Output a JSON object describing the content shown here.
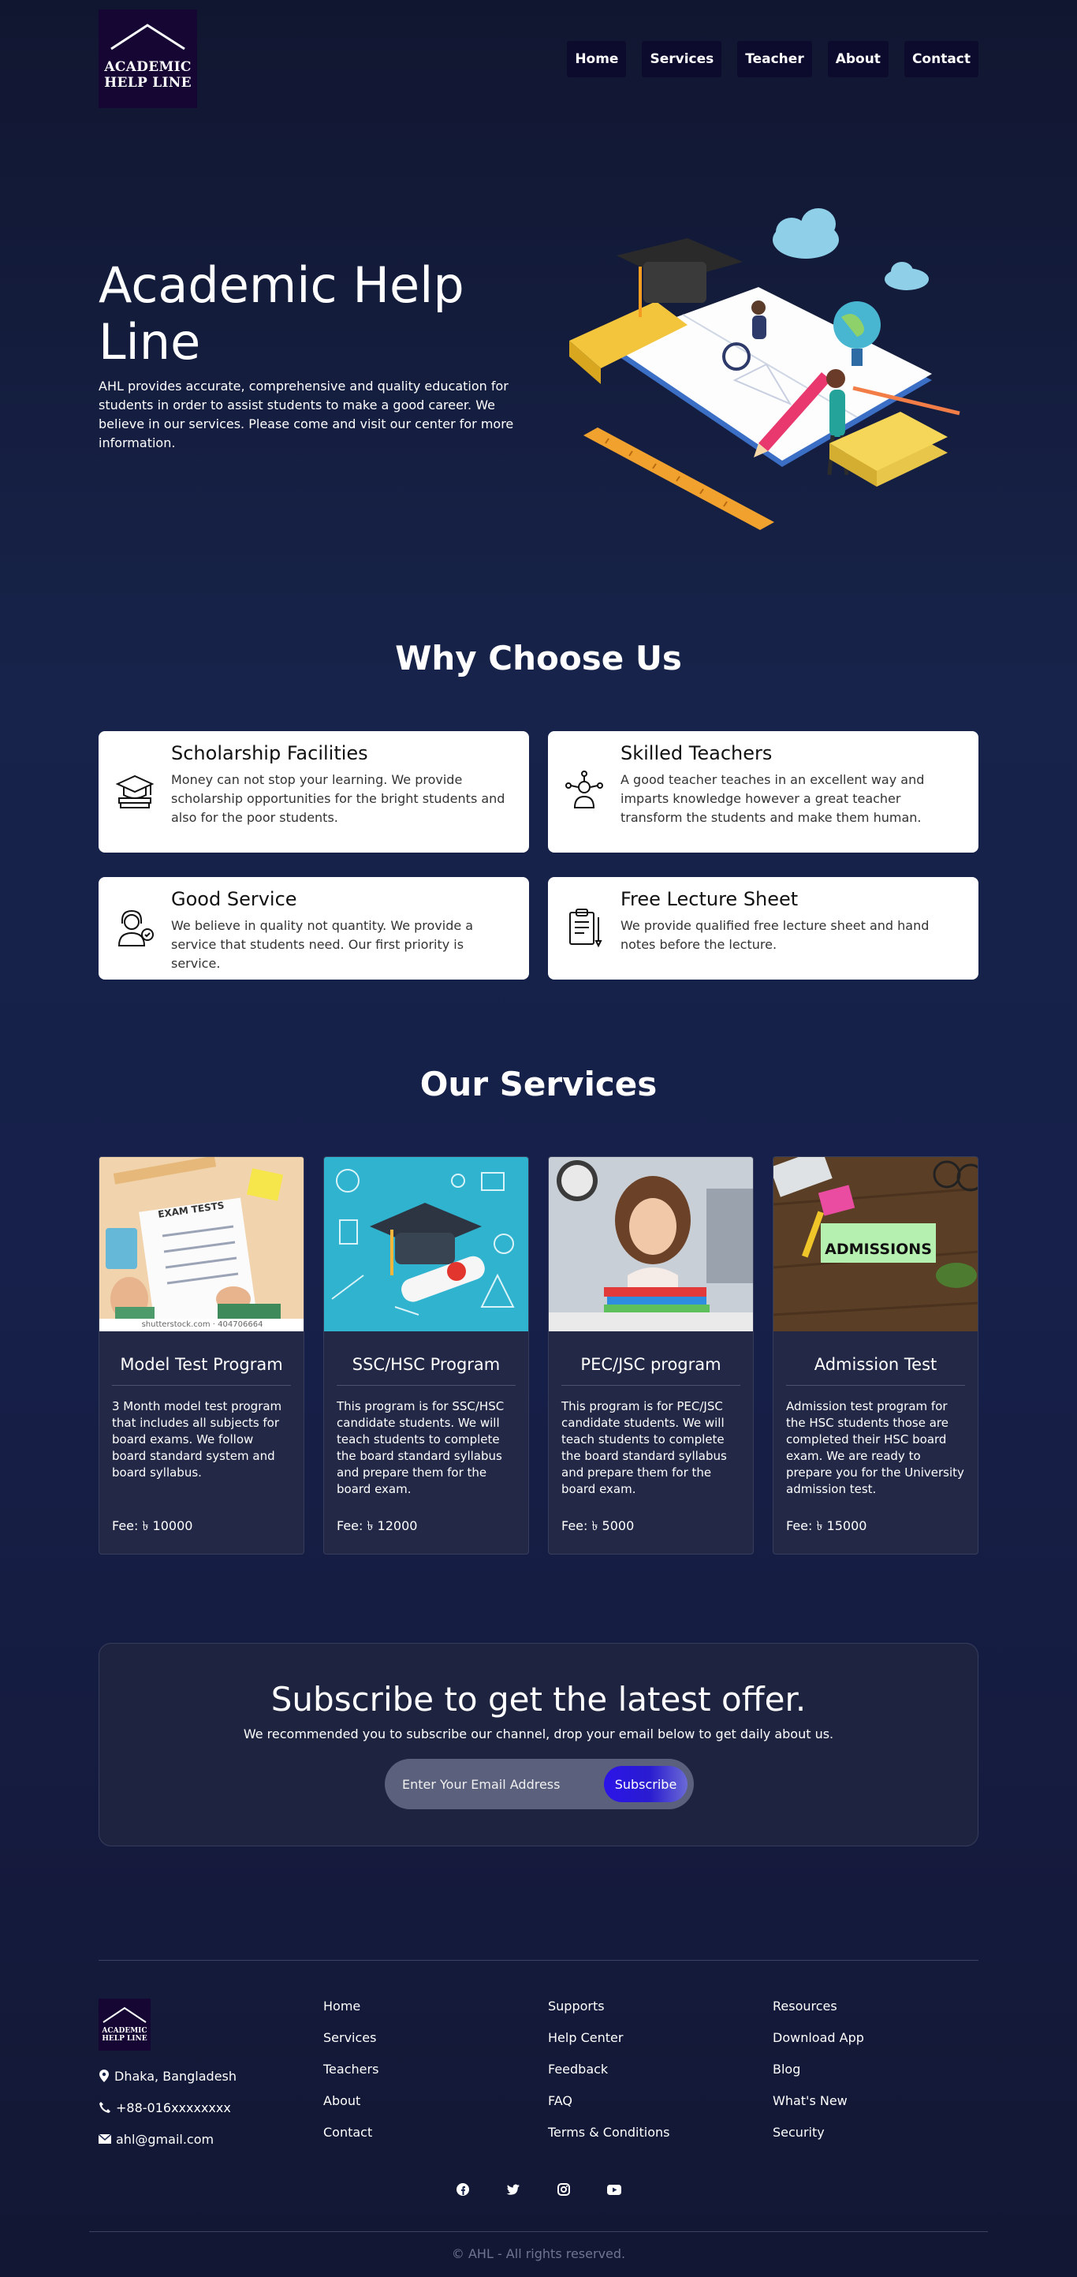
{
  "brand": {
    "logo_line1": "ACADEMIC",
    "logo_line2": "HELP LINE"
  },
  "nav": [
    {
      "label": "Home"
    },
    {
      "label": "Services"
    },
    {
      "label": "Teacher"
    },
    {
      "label": "About"
    },
    {
      "label": "Contact"
    }
  ],
  "hero": {
    "title": "Academic Help Line",
    "description": "AHL provides accurate, comprehensive and quality education for students in order to assist students to make a good career. We believe in our services. Please come and visit our center for more information."
  },
  "why": {
    "title": "Why Choose Us",
    "cards": [
      {
        "title": "Scholarship Facilities",
        "text": "Money can not stop your learning. We provide scholarship opportunities for the bright students and also for the poor students.",
        "icon": "graduation-books-icon"
      },
      {
        "title": "Skilled Teachers",
        "text": "A good teacher teaches in an excellent way and imparts knowledge however a great teacher transform the students and make them human.",
        "icon": "teacher-network-icon"
      },
      {
        "title": "Good Service",
        "text": "We believe in quality not quantity. We provide a service that students need. Our first priority is service.",
        "icon": "support-agent-icon"
      },
      {
        "title": "Free Lecture Sheet",
        "text": "We provide qualified free lecture sheet and hand notes before the lecture.",
        "icon": "lecture-sheet-icon"
      }
    ]
  },
  "services": {
    "title": "Our Services",
    "cards": [
      {
        "title": "Model Test Program",
        "text": "3 Month model test program that includes all subjects for board exams. We follow board standard system and board syllabus.",
        "fee": "Fee: ৳ 10000",
        "image_caption": "EXAM TESTS",
        "image_credit": "shutterstock.com · 404706664"
      },
      {
        "title": "SSC/HSC Program",
        "text": "This program is for SSC/HSC candidate students. We will teach students to complete the board standard syllabus and prepare them for the board exam.",
        "fee": "Fee: ৳ 12000"
      },
      {
        "title": "PEC/JSC program",
        "text": "This program is for PEC/JSC candidate students. We will teach students to complete the board standard syllabus and prepare them for the board exam.",
        "fee": "Fee: ৳ 5000"
      },
      {
        "title": "Admission Test",
        "text": "Admission test program for the HSC students those are completed their HSC board exam. We are ready to prepare you for the University admission test.",
        "fee": "Fee: ৳ 15000",
        "image_caption": "ADMISSIONS"
      }
    ]
  },
  "subscribe": {
    "title": "Subscribe to get the latest offer.",
    "subtitle": "We recommended you to subscribe our channel, drop your email below to get daily about us.",
    "placeholder": "Enter Your Email Address",
    "button": "Subscribe"
  },
  "footer": {
    "contact": {
      "address": "Dhaka, Bangladesh",
      "phone": "+88-016xxxxxxxx",
      "email": "ahl@gmail.com"
    },
    "col1": [
      "Home",
      "Services",
      "Teachers",
      "About",
      "Contact"
    ],
    "col2": [
      "Supports",
      "Help Center",
      "Feedback",
      "FAQ",
      "Terms & Conditions"
    ],
    "col3": [
      "Resources",
      "Download App",
      "Blog",
      "What's New",
      "Security"
    ],
    "socials": [
      "facebook-icon",
      "twitter-icon",
      "instagram-icon",
      "youtube-icon"
    ],
    "copyright": "© AHL - All rights reserved."
  }
}
